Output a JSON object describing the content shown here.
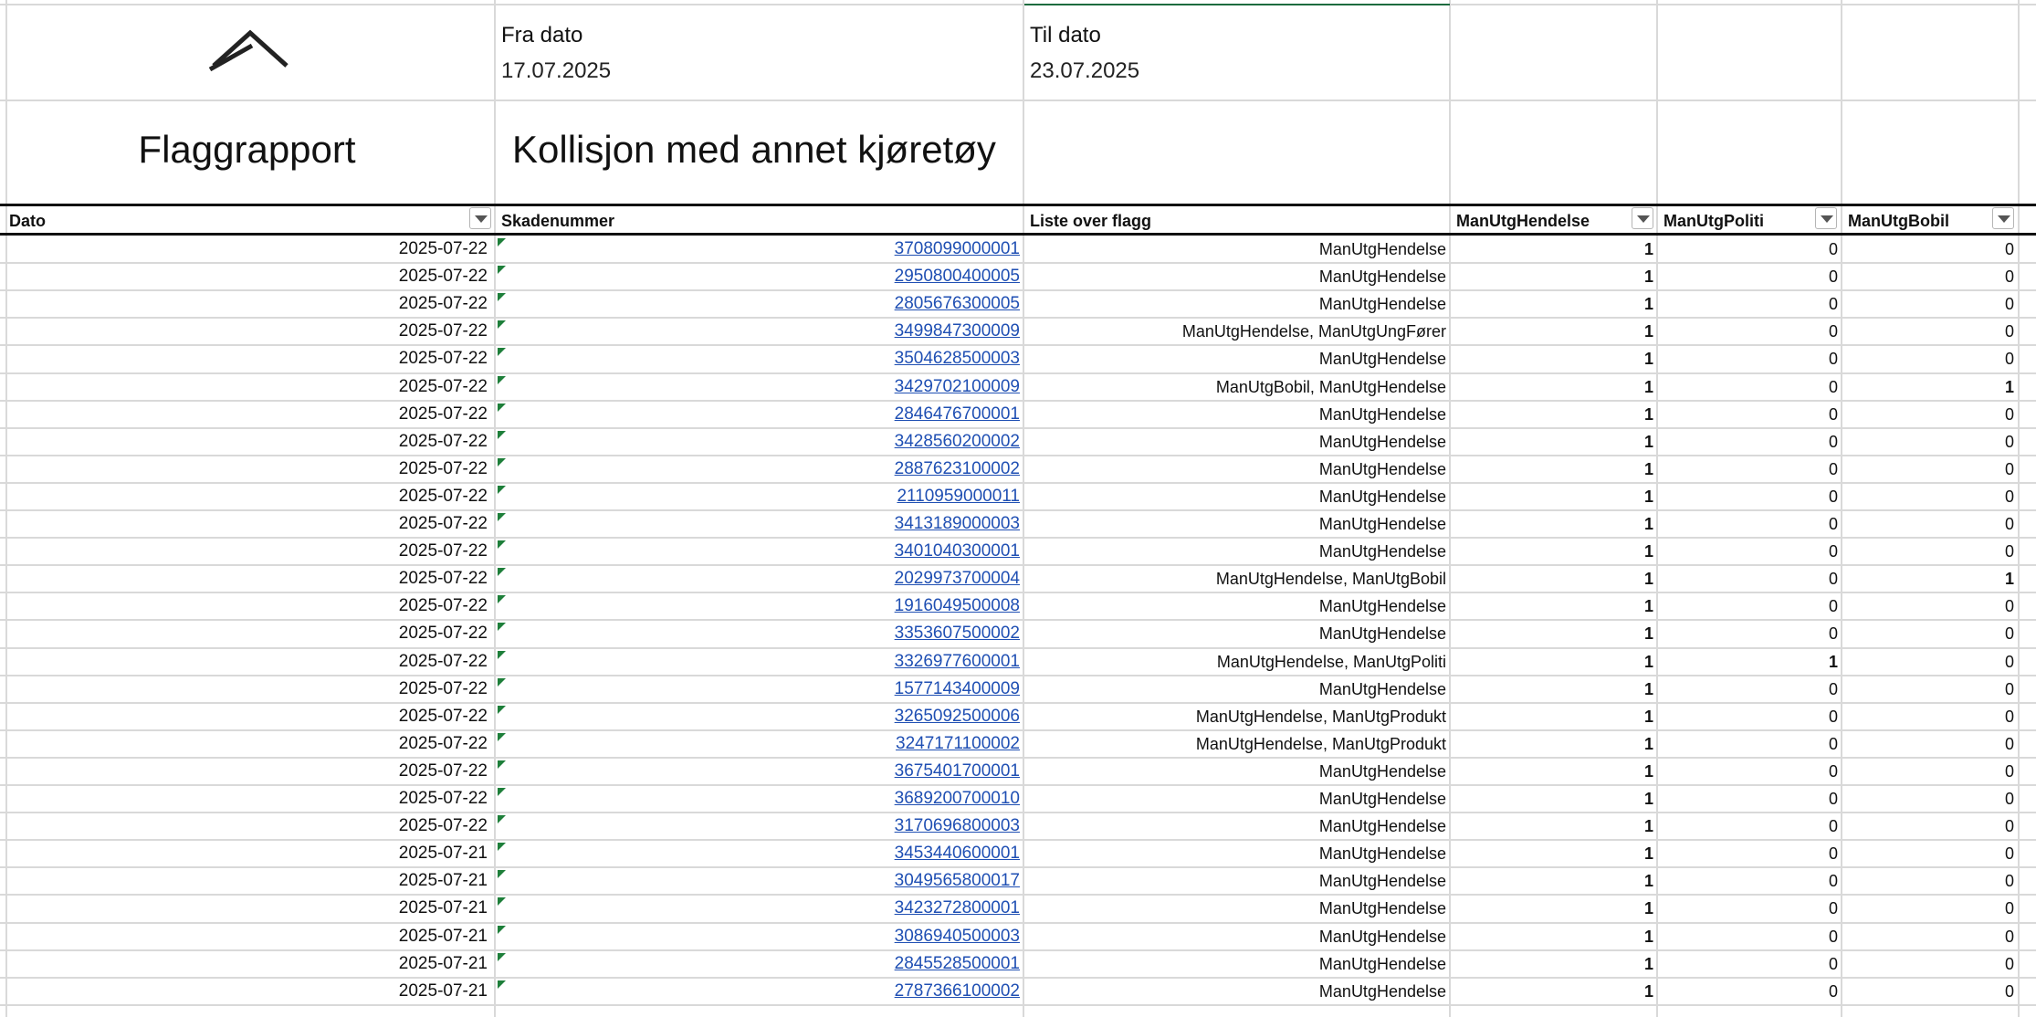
{
  "report": {
    "from_label": "Fra dato",
    "from_value": "17.07.2025",
    "to_label": "Til dato",
    "to_value": "23.07.2025",
    "title": "Flaggrapport",
    "subtitle": "Kollisjon med annet kjøretøy"
  },
  "logo_icon": "chevron-up-logo",
  "columns": [
    {
      "label": "Dato"
    },
    {
      "label": "Skadenummer"
    },
    {
      "label": "Liste over flagg"
    },
    {
      "label": "ManUtgHendelse"
    },
    {
      "label": "ManUtgPoliti"
    },
    {
      "label": "ManUtgBobil"
    }
  ],
  "colors": {
    "link": "#1f4fb3",
    "selection_border": "#1d6b3f",
    "error_indicator": "#1e7f3a"
  },
  "rows": [
    {
      "date": "2025-07-22",
      "claim": "3708099000001",
      "flags": "ManUtgHendelse",
      "hendelse": "1",
      "politi": "0",
      "bobil": "0"
    },
    {
      "date": "2025-07-22",
      "claim": "2950800400005",
      "flags": "ManUtgHendelse",
      "hendelse": "1",
      "politi": "0",
      "bobil": "0"
    },
    {
      "date": "2025-07-22",
      "claim": "2805676300005",
      "flags": "ManUtgHendelse",
      "hendelse": "1",
      "politi": "0",
      "bobil": "0"
    },
    {
      "date": "2025-07-22",
      "claim": "3499847300009",
      "flags": "ManUtgHendelse, ManUtgUngFører",
      "hendelse": "1",
      "politi": "0",
      "bobil": "0"
    },
    {
      "date": "2025-07-22",
      "claim": "3504628500003",
      "flags": "ManUtgHendelse",
      "hendelse": "1",
      "politi": "0",
      "bobil": "0"
    },
    {
      "date": "2025-07-22",
      "claim": "3429702100009",
      "flags": "ManUtgBobil, ManUtgHendelse",
      "hendelse": "1",
      "politi": "0",
      "bobil": "1"
    },
    {
      "date": "2025-07-22",
      "claim": "2846476700001",
      "flags": "ManUtgHendelse",
      "hendelse": "1",
      "politi": "0",
      "bobil": "0"
    },
    {
      "date": "2025-07-22",
      "claim": "3428560200002",
      "flags": "ManUtgHendelse",
      "hendelse": "1",
      "politi": "0",
      "bobil": "0"
    },
    {
      "date": "2025-07-22",
      "claim": "2887623100002",
      "flags": "ManUtgHendelse",
      "hendelse": "1",
      "politi": "0",
      "bobil": "0"
    },
    {
      "date": "2025-07-22",
      "claim": "2110959000011",
      "flags": "ManUtgHendelse",
      "hendelse": "1",
      "politi": "0",
      "bobil": "0"
    },
    {
      "date": "2025-07-22",
      "claim": "3413189000003",
      "flags": "ManUtgHendelse",
      "hendelse": "1",
      "politi": "0",
      "bobil": "0"
    },
    {
      "date": "2025-07-22",
      "claim": "3401040300001",
      "flags": "ManUtgHendelse",
      "hendelse": "1",
      "politi": "0",
      "bobil": "0"
    },
    {
      "date": "2025-07-22",
      "claim": "2029973700004",
      "flags": "ManUtgHendelse, ManUtgBobil",
      "hendelse": "1",
      "politi": "0",
      "bobil": "1"
    },
    {
      "date": "2025-07-22",
      "claim": "1916049500008",
      "flags": "ManUtgHendelse",
      "hendelse": "1",
      "politi": "0",
      "bobil": "0"
    },
    {
      "date": "2025-07-22",
      "claim": "3353607500002",
      "flags": "ManUtgHendelse",
      "hendelse": "1",
      "politi": "0",
      "bobil": "0"
    },
    {
      "date": "2025-07-22",
      "claim": "3326977600001",
      "flags": "ManUtgHendelse, ManUtgPoliti",
      "hendelse": "1",
      "politi": "1",
      "bobil": "0"
    },
    {
      "date": "2025-07-22",
      "claim": "1577143400009",
      "flags": "ManUtgHendelse",
      "hendelse": "1",
      "politi": "0",
      "bobil": "0"
    },
    {
      "date": "2025-07-22",
      "claim": "3265092500006",
      "flags": "ManUtgHendelse, ManUtgProdukt",
      "hendelse": "1",
      "politi": "0",
      "bobil": "0"
    },
    {
      "date": "2025-07-22",
      "claim": "3247171100002",
      "flags": "ManUtgHendelse, ManUtgProdukt",
      "hendelse": "1",
      "politi": "0",
      "bobil": "0"
    },
    {
      "date": "2025-07-22",
      "claim": "3675401700001",
      "flags": "ManUtgHendelse",
      "hendelse": "1",
      "politi": "0",
      "bobil": "0"
    },
    {
      "date": "2025-07-22",
      "claim": "3689200700010",
      "flags": "ManUtgHendelse",
      "hendelse": "1",
      "politi": "0",
      "bobil": "0"
    },
    {
      "date": "2025-07-22",
      "claim": "3170696800003",
      "flags": "ManUtgHendelse",
      "hendelse": "1",
      "politi": "0",
      "bobil": "0"
    },
    {
      "date": "2025-07-21",
      "claim": "3453440600001",
      "flags": "ManUtgHendelse",
      "hendelse": "1",
      "politi": "0",
      "bobil": "0"
    },
    {
      "date": "2025-07-21",
      "claim": "3049565800017",
      "flags": "ManUtgHendelse",
      "hendelse": "1",
      "politi": "0",
      "bobil": "0"
    },
    {
      "date": "2025-07-21",
      "claim": "3423272800001",
      "flags": "ManUtgHendelse",
      "hendelse": "1",
      "politi": "0",
      "bobil": "0"
    },
    {
      "date": "2025-07-21",
      "claim": "3086940500003",
      "flags": "ManUtgHendelse",
      "hendelse": "1",
      "politi": "0",
      "bobil": "0"
    },
    {
      "date": "2025-07-21",
      "claim": "2845528500001",
      "flags": "ManUtgHendelse",
      "hendelse": "1",
      "politi": "0",
      "bobil": "0"
    },
    {
      "date": "2025-07-21",
      "claim": "2787366100002",
      "flags": "ManUtgHendelse",
      "hendelse": "1",
      "politi": "0",
      "bobil": "0"
    }
  ]
}
